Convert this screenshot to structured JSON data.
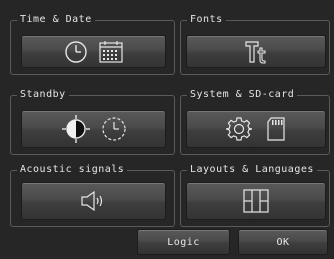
{
  "groups": {
    "time_date": {
      "title": "Time & Date",
      "icons": [
        "clock-icon",
        "calendar-icon"
      ]
    },
    "fonts": {
      "title": "Fonts",
      "icons": [
        "font-icon"
      ]
    },
    "standby": {
      "title": "Standby",
      "icons": [
        "brightness-icon",
        "timer-icon"
      ]
    },
    "system_sd": {
      "title": "System & SD-card",
      "icons": [
        "gear-icon",
        "sd-card-icon"
      ]
    },
    "acoustic": {
      "title": "Acoustic signals",
      "icons": [
        "speaker-icon"
      ]
    },
    "layouts": {
      "title": "Layouts & Languages",
      "icons": [
        "layout-icon"
      ]
    }
  },
  "footer": {
    "logic_label": "Logic",
    "ok_label": "OK"
  },
  "colors": {
    "background": "#262626",
    "button_top": "#5a5a5a",
    "button_bottom": "#333333",
    "border": "#5a5a5a",
    "text": "#e6e6e6"
  }
}
